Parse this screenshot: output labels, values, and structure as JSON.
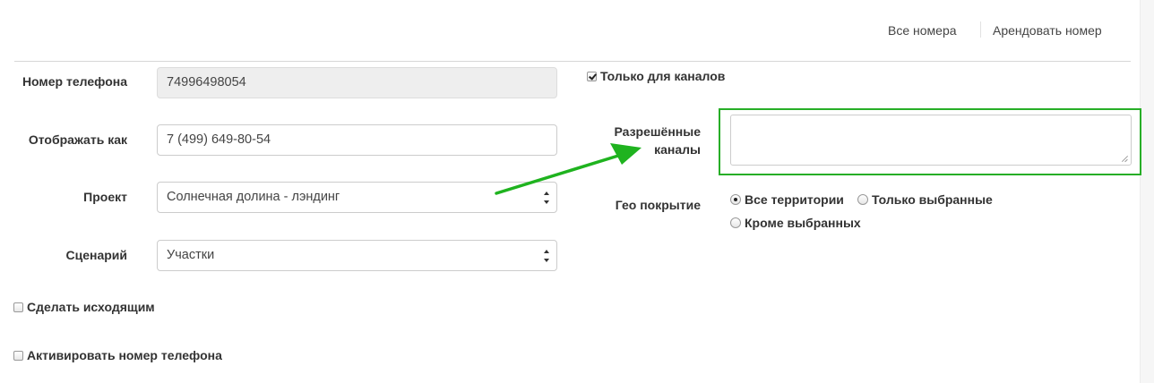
{
  "header": {
    "all_numbers_link": "Все номера",
    "rent_number_link": "Арендовать номер"
  },
  "form": {
    "phone": {
      "label": "Номер телефона",
      "value": "74996498054"
    },
    "display_as": {
      "label": "Отображать как",
      "value": "7 (499) 649-80-54"
    },
    "project": {
      "label": "Проект",
      "selected": "Солнечная долина - лэндинг"
    },
    "scenario": {
      "label": "Сценарий",
      "selected": "Участки"
    },
    "make_outgoing": {
      "label": "Сделать исходящим",
      "checked": false
    },
    "activate_phone": {
      "label": "Активировать номер телефона",
      "checked": false
    },
    "channels_only": {
      "label": "Только для каналов",
      "checked": true
    },
    "allowed_channels": {
      "label_line1": "Разрешённые",
      "label_line2": "каналы",
      "value": ""
    },
    "geo": {
      "label": "Гео покрытие",
      "options": [
        "Все территории",
        "Только выбранные",
        "Кроме выбранных"
      ],
      "selected": "Все территории"
    }
  },
  "annotation": {
    "color": "#1fb31f"
  }
}
